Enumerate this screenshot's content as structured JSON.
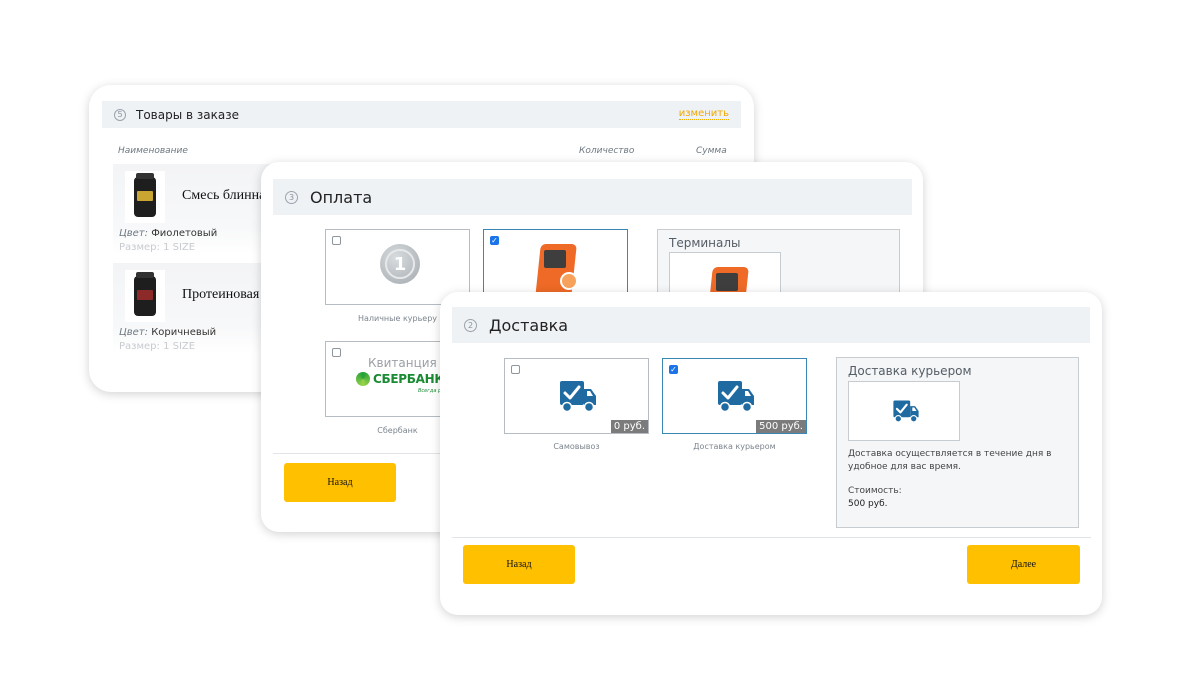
{
  "order": {
    "step": "5",
    "title": "Товары в заказе",
    "change_link": "изменить",
    "columns": {
      "name": "Наименование",
      "quantity": "Количество",
      "sum": "Сумма"
    },
    "products": [
      {
        "name": "Смесь блинна",
        "color_label": "Цвет:",
        "color_value": "Фиолетовый",
        "size": "Размер: 1 SIZE"
      },
      {
        "name": "Протеиновая ,",
        "color_label": "Цвет:",
        "color_value": "Коричневый",
        "size": "Размер: 1 SIZE"
      }
    ]
  },
  "payment": {
    "step": "3",
    "title": "Оплата",
    "options": [
      {
        "caption": "Наличные курьеру",
        "checked": false,
        "icon": "coin-icon"
      },
      {
        "caption": "",
        "checked": true,
        "icon": "terminal-kiosk-icon"
      },
      {
        "caption": "Сбербанк",
        "checked": false,
        "icon": "sberbank-logo",
        "label": "Квитанция",
        "logo_text": "СБЕРБАНК",
        "logo_sub": "Всегда рядом"
      }
    ],
    "panel": {
      "title": "Терминалы"
    },
    "back_button": "Назад"
  },
  "delivery": {
    "step": "2",
    "title": "Доставка",
    "options": [
      {
        "caption": "Самовывоз",
        "price": "0 руб.",
        "checked": false,
        "icon": "truck-check-icon"
      },
      {
        "caption": "Доставка курьером",
        "price": "500 руб.",
        "checked": true,
        "icon": "truck-check-icon"
      }
    ],
    "panel": {
      "title": "Доставка курьером",
      "description": "Доставка осуществляется в течение дня в удобное для вас время.",
      "cost_label": "Стоимость:",
      "cost_value": "500 руб."
    },
    "back_button": "Назад",
    "next_button": "Далее"
  },
  "colors": {
    "accent_yellow": "#ffc000",
    "truck_blue": "#1f6aa0",
    "kiosk_orange": "#ee6a26",
    "link_orange": "#f2a900"
  }
}
